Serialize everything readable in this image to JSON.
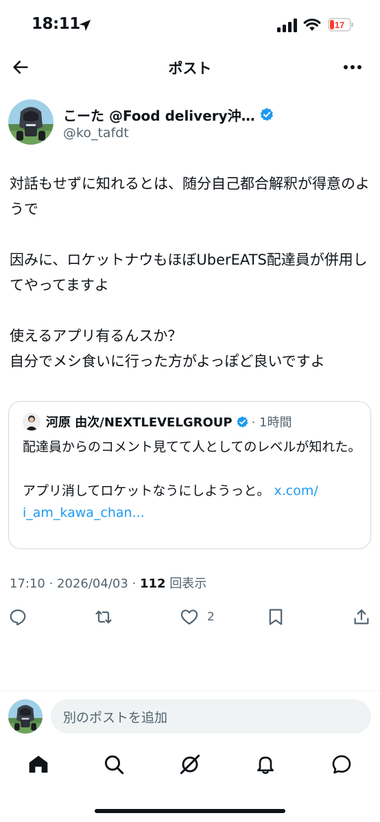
{
  "status_bar": {
    "time": "18:11",
    "battery": "17",
    "battery_color": "#ff3b30"
  },
  "header": {
    "title": "ポスト",
    "back_icon": "arrow-left-icon",
    "more_icon": "more-horizontal-icon"
  },
  "post": {
    "author_name": "こーた @Food delivery沖…",
    "author_handle": "@ko_tafdt",
    "text": "対話もせずに知れるとは、随分自己都合解釈が得意のようで\n\n因みに、ロケットナウもほぼUberEATS配達員が併用してやってますよ\n\n使えるアプリ有るんスか？\n自分でメシ食いに行った方がよっぽど良いですよ",
    "quote": {
      "author_name": "河原 由次/NEXTLEVELGROUP",
      "time": "· 1時間",
      "text": "配達員からのコメント見てて人としてのレベルが知れた。\n\nアプリ消してロケットなうにしようっと。 ",
      "link": "x.com/\ni_am_kawa_chan..."
    },
    "meta_time": "17:10 · 2026/04/03 · ",
    "views": "112",
    "views_label": " 回表示",
    "likes": "2"
  },
  "actions": [
    {
      "name": "reply",
      "icon": "reply-icon"
    },
    {
      "name": "repost",
      "icon": "repost-icon"
    },
    {
      "name": "like",
      "icon": "heart-icon"
    },
    {
      "name": "bookmark",
      "icon": "bookmark-icon"
    },
    {
      "name": "share",
      "icon": "share-icon"
    }
  ],
  "reply_bar": {
    "placeholder": "別のポストを追加"
  },
  "tab_bar": [
    {
      "name": "home",
      "icon": "home-icon"
    },
    {
      "name": "search",
      "icon": "search-icon"
    },
    {
      "name": "grok",
      "icon": "grok-icon"
    },
    {
      "name": "notifications",
      "icon": "bell-icon"
    },
    {
      "name": "messages",
      "icon": "messages-icon"
    }
  ],
  "colors": {
    "accent": "#1d9bf0",
    "text": "#0f1419",
    "secondary": "#536471"
  }
}
